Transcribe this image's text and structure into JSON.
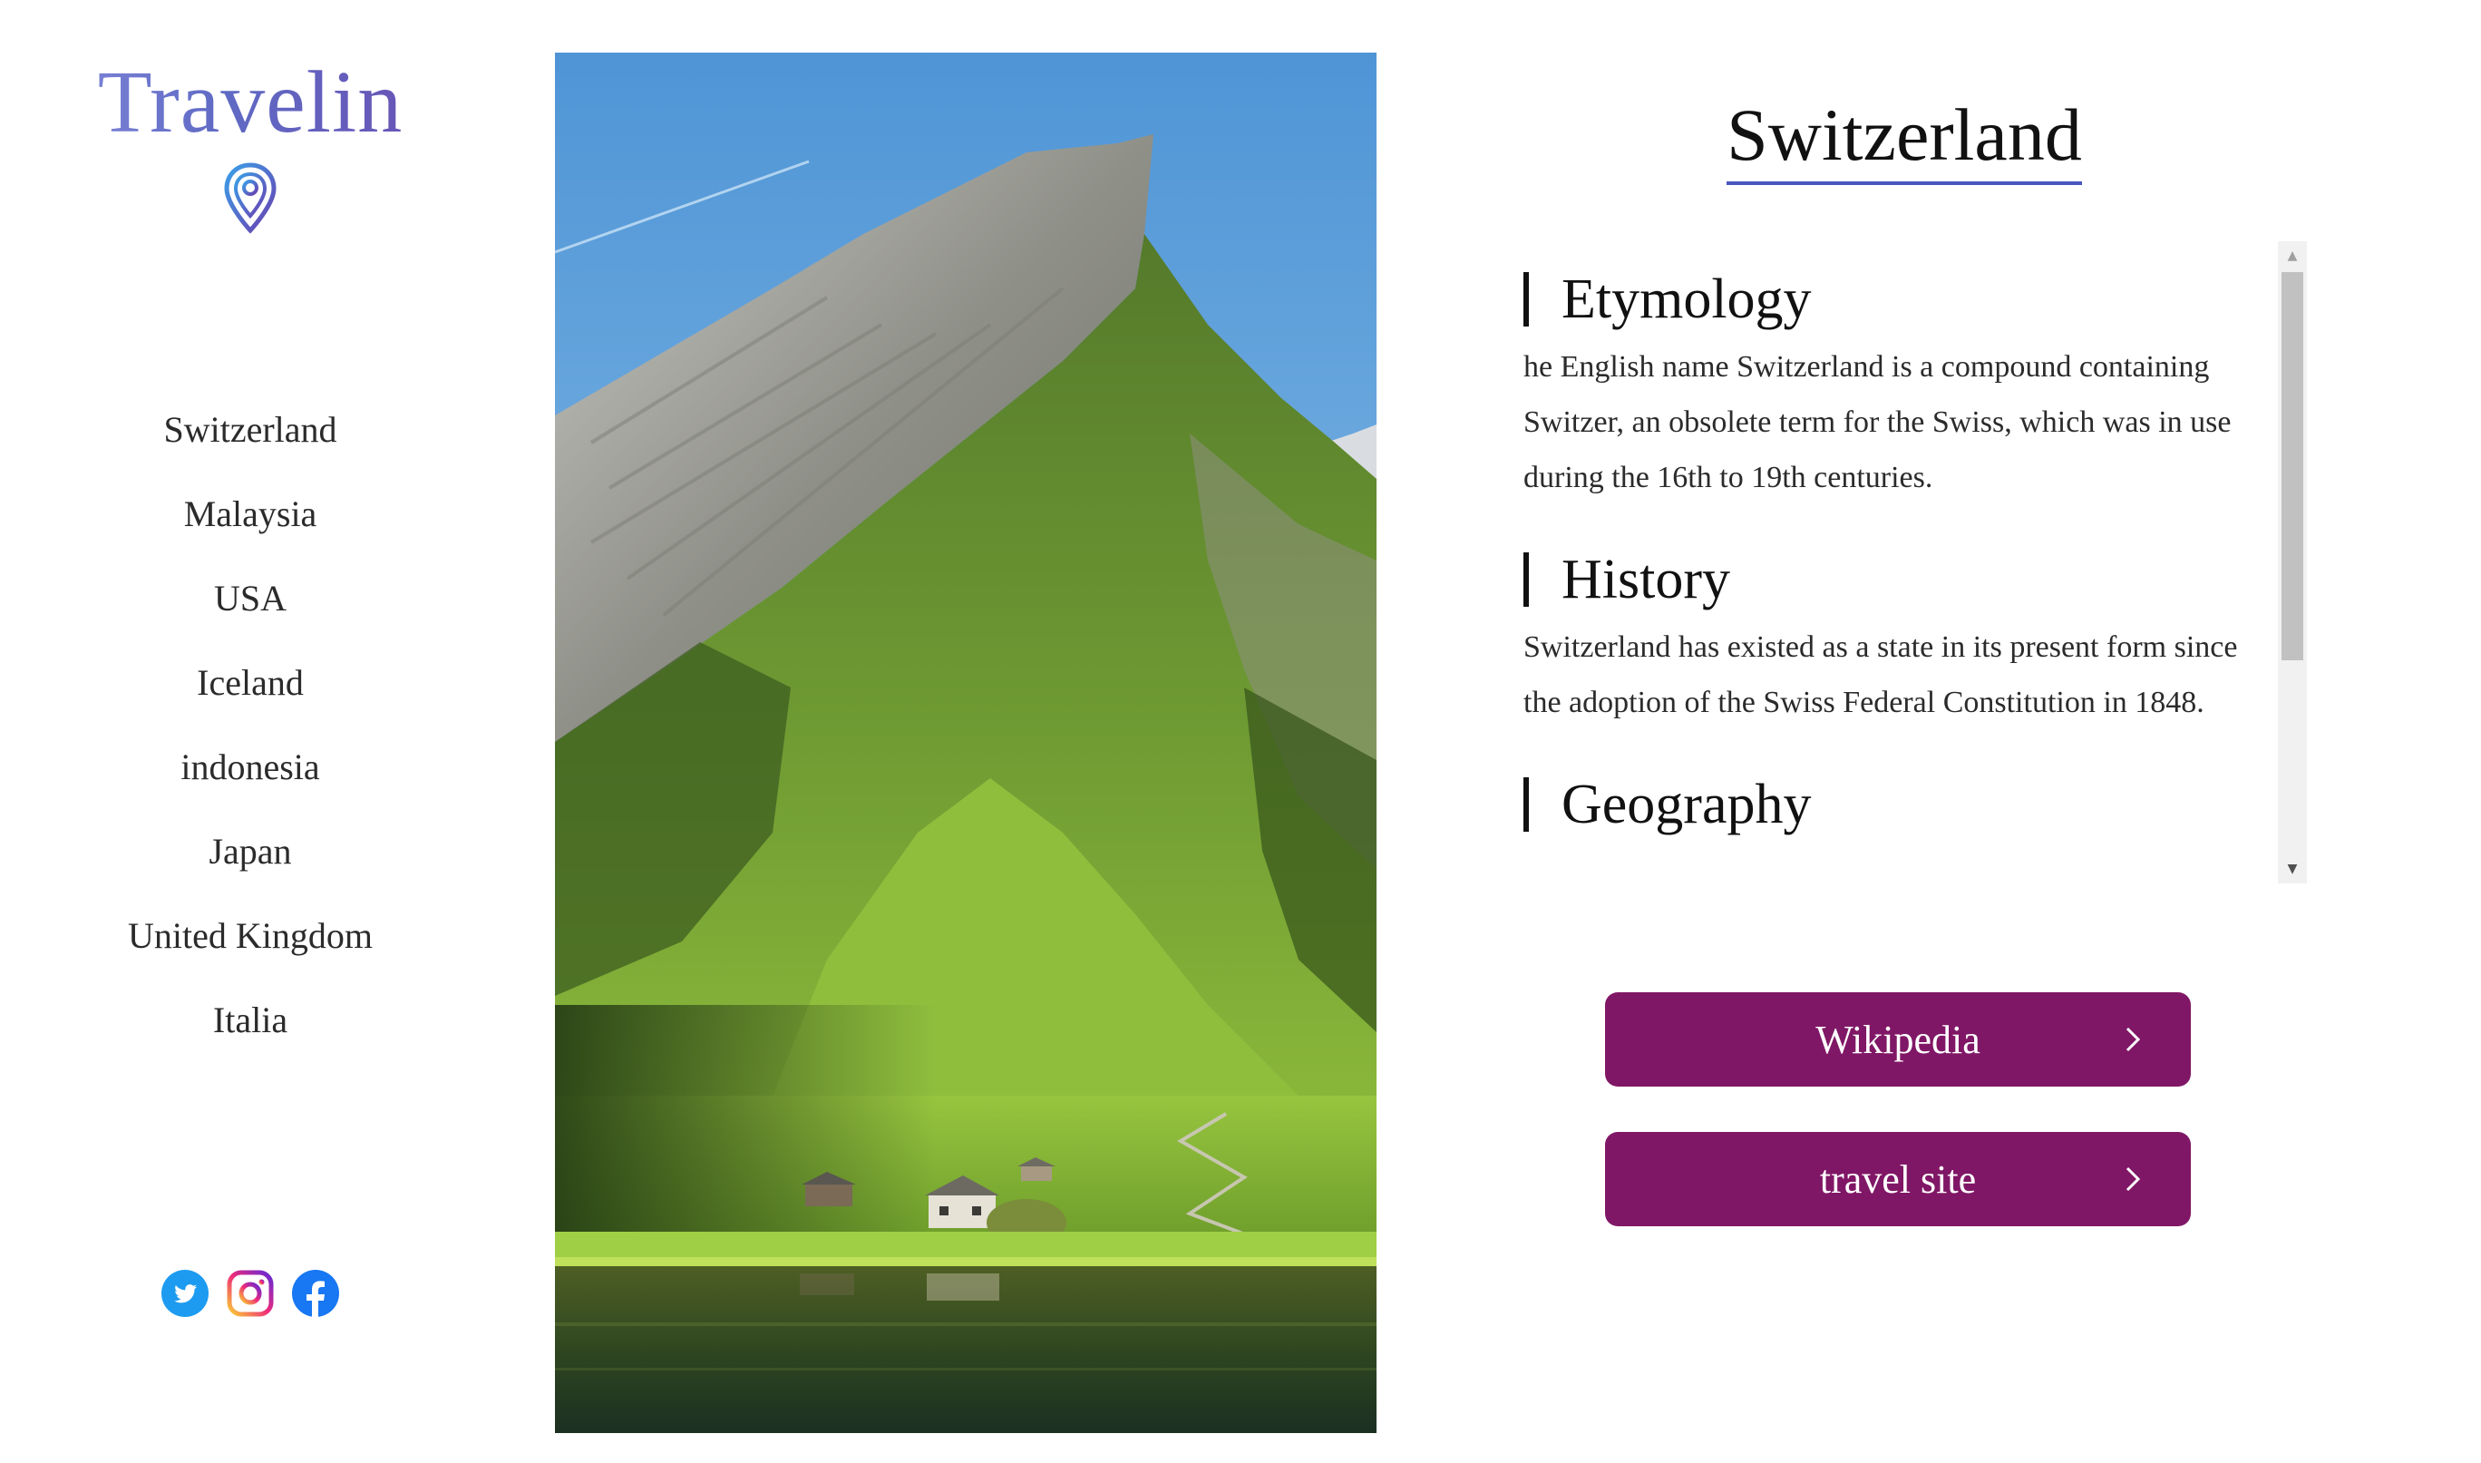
{
  "brand": {
    "name": "Travelin",
    "logo_icon": "location-pin-icon",
    "colors": [
      "#8a8fe0",
      "#5f6ac4",
      "#6c4bb0"
    ]
  },
  "nav": {
    "items": [
      {
        "label": "Switzerland"
      },
      {
        "label": "Malaysia"
      },
      {
        "label": "USA"
      },
      {
        "label": "Iceland"
      },
      {
        "label": "indonesia"
      },
      {
        "label": "Japan"
      },
      {
        "label": "United Kingdom"
      },
      {
        "label": "Italia"
      }
    ]
  },
  "social": {
    "icons": [
      "twitter-icon",
      "instagram-icon",
      "facebook-icon"
    ]
  },
  "main": {
    "title": "Switzerland",
    "underline_color": "#4a56c0",
    "sections": [
      {
        "heading": "Etymology",
        "body": "he English name Switzerland is a compound containing Switzer, an obsolete term for the Swiss, which was in use during the 16th to 19th centuries."
      },
      {
        "heading": "History",
        "body": "Switzerland has existed as a state in its present form since the adoption of the Swiss Federal Constitution in 1848."
      },
      {
        "heading": "Geography",
        "body": ""
      }
    ]
  },
  "buttons": {
    "wikipedia": "Wikipedia",
    "travel_site": "travel site",
    "color": "#801766",
    "icon": "chevron-right-icon"
  }
}
